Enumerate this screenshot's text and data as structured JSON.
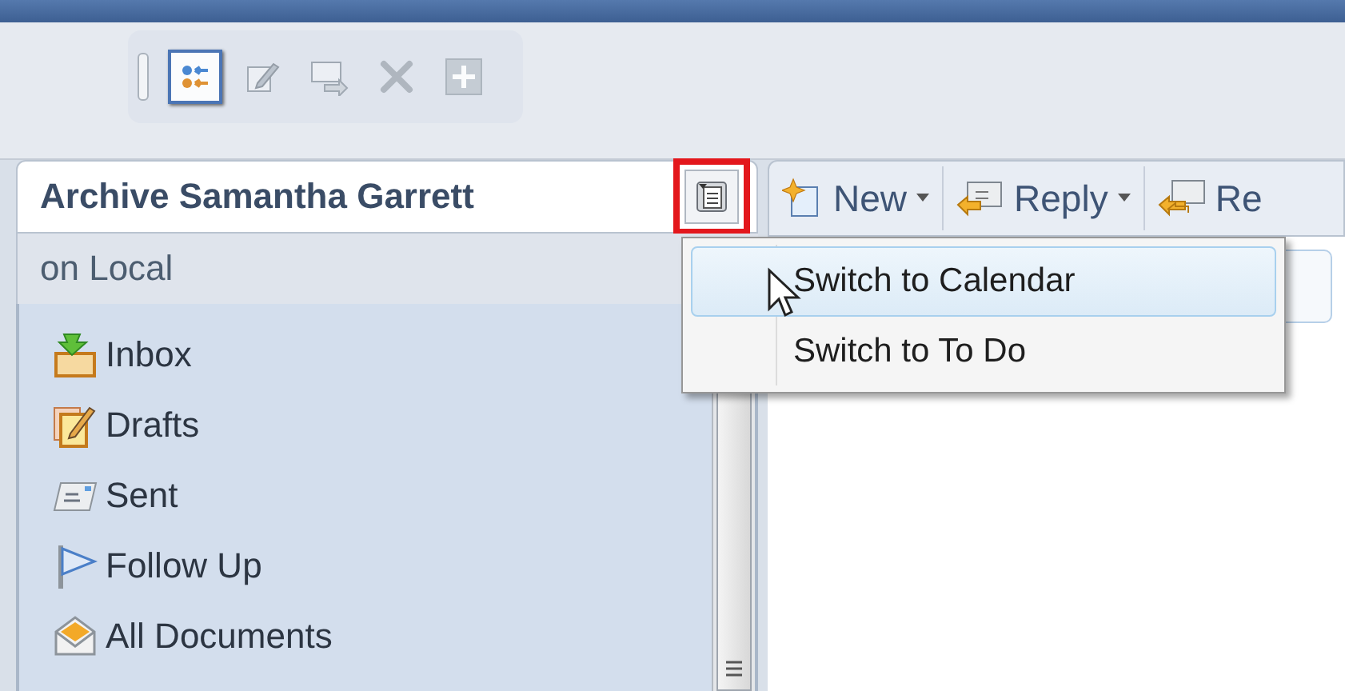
{
  "toolbar": {
    "buttons": [
      {
        "kind": "filter",
        "selected": true
      },
      {
        "kind": "edit",
        "selected": false
      },
      {
        "kind": "forward",
        "selected": false
      },
      {
        "kind": "delete",
        "selected": false
      },
      {
        "kind": "add",
        "selected": false
      }
    ]
  },
  "folder_panel": {
    "title": "Archive Samantha Garrett",
    "subtitle": "on Local",
    "view_switch": {
      "highlighted": true
    },
    "folders": [
      {
        "label": "Inbox",
        "kind": "inbox"
      },
      {
        "label": "Drafts",
        "kind": "drafts"
      },
      {
        "label": "Sent",
        "kind": "sent"
      },
      {
        "label": "Follow Up",
        "kind": "flag"
      },
      {
        "label": "All Documents",
        "kind": "documents"
      }
    ]
  },
  "action_bar": {
    "buttons": [
      {
        "label": "New",
        "kind": "new",
        "dropdown": true
      },
      {
        "label": "Reply",
        "kind": "reply",
        "dropdown": true
      },
      {
        "label": "Re",
        "kind": "reply-all",
        "dropdown": false
      }
    ]
  },
  "view_menu": {
    "items": [
      {
        "label": "Switch to Calendar",
        "selected": true
      },
      {
        "label": "Switch to To Do",
        "selected": false
      }
    ]
  }
}
